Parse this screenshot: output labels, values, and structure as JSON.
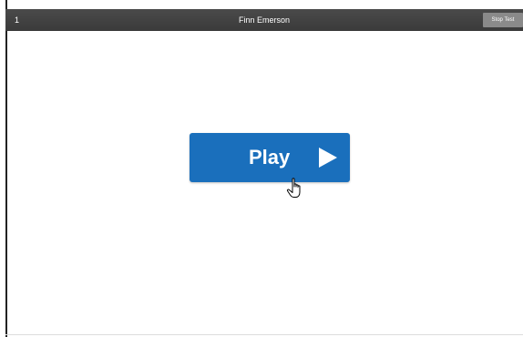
{
  "topbar": {
    "item_number": "1",
    "student_name": "Finn Emerson",
    "stop_label": "Stop Test"
  },
  "main": {
    "play_label": "Play"
  },
  "icons": {
    "play": "play-triangle-icon",
    "cursor": "hand-pointer-cursor-icon"
  },
  "colors": {
    "topbar": "#3f3f3f",
    "play_button": "#1a6fbc",
    "stop_button": "#8a8a8a"
  }
}
